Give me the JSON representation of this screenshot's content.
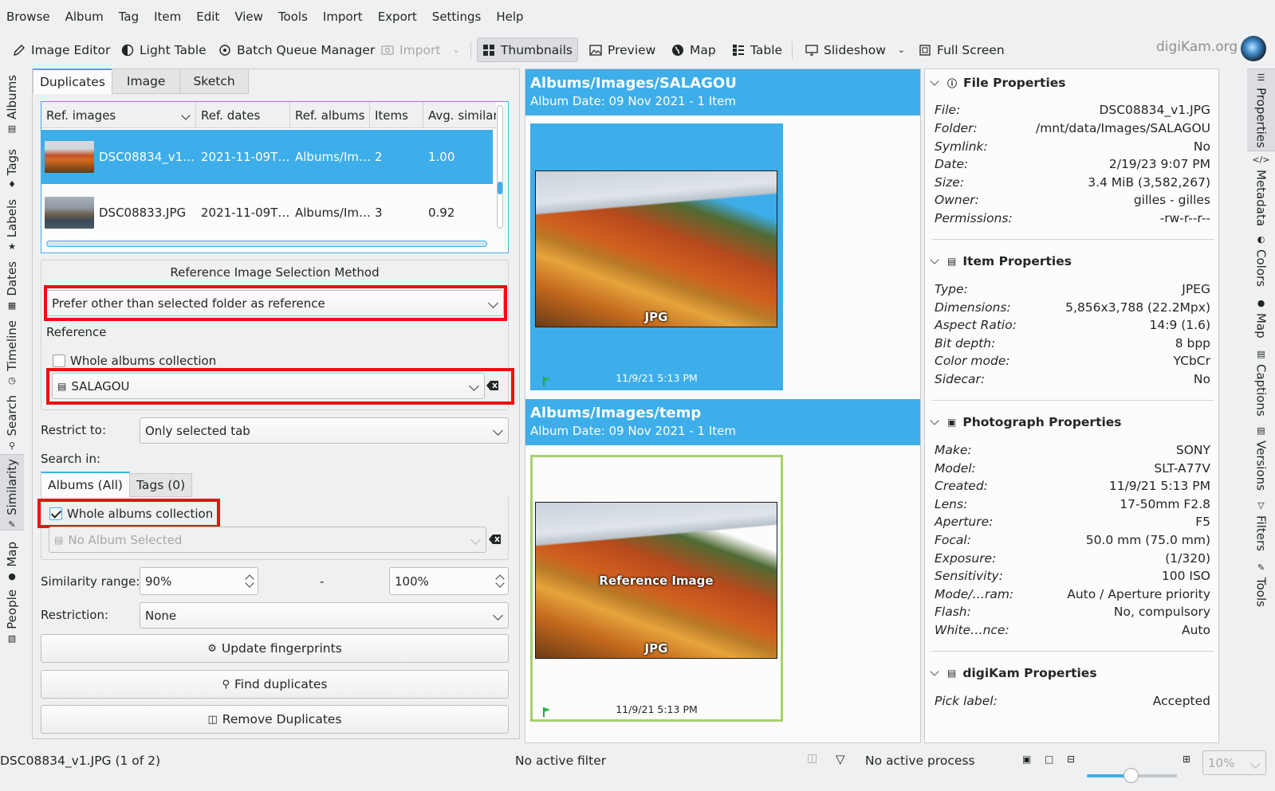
{
  "menu": [
    "Browse",
    "Album",
    "Tag",
    "Item",
    "Edit",
    "View",
    "Tools",
    "Import",
    "Export",
    "Settings",
    "Help"
  ],
  "toolbar": {
    "image_editor": "Image Editor",
    "light_table": "Light Table",
    "batch_queue": "Batch Queue Manager",
    "import": "Import",
    "thumbnails": "Thumbnails",
    "preview": "Preview",
    "map": "Map",
    "table": "Table",
    "slideshow": "Slideshow",
    "full_screen": "Full Screen",
    "brand": "digiKam.org"
  },
  "left_sidebar": [
    "Albums",
    "Tags",
    "Labels",
    "Dates",
    "Timeline",
    "Search",
    "Similarity",
    "Map",
    "People"
  ],
  "right_sidebar": [
    "Properties",
    "Metadata",
    "Colors",
    "Map",
    "Captions",
    "Versions",
    "Filters",
    "Tools"
  ],
  "panel_tabs": [
    "Duplicates",
    "Image",
    "Sketch"
  ],
  "table": {
    "headers": [
      "Ref. images",
      "Ref. dates",
      "Ref. albums",
      "Items",
      "Avg. similar"
    ],
    "rows": [
      {
        "name": "DSC08834_v1…",
        "date": "2021-11-09T…",
        "album": "Albums/Im…",
        "items": "2",
        "similarity": "1.00"
      },
      {
        "name": "DSC08833.JPG",
        "date": "2021-11-09T…",
        "album": "Albums/Im…",
        "items": "3",
        "similarity": "0.92"
      }
    ]
  },
  "ref_method": {
    "title": "Reference Image Selection Method",
    "value": "Prefer other than selected folder as reference",
    "reference_label": "Reference",
    "whole_albums": "Whole albums collection",
    "album": "SALAGOU"
  },
  "restrict": {
    "label": "Restrict to:",
    "value": "Only selected tab"
  },
  "search_in": {
    "label": "Search in:",
    "tabs": [
      "Albums (All)",
      "Tags (0)"
    ],
    "whole_albums": "Whole albums collection",
    "album_placeholder": "No Album Selected"
  },
  "similarity": {
    "label": "Similarity range:",
    "min": "90%",
    "dash": "-",
    "max": "100%"
  },
  "restriction": {
    "label": "Restriction:",
    "value": "None"
  },
  "buttons": {
    "update": "Update fingerprints",
    "find": "Find duplicates",
    "remove": "Remove Duplicates"
  },
  "albums": [
    {
      "title": "Albums/Images/SALAGOU",
      "subtitle": "Album Date: 09 Nov 2021 - 1 Item",
      "format": "JPG",
      "overlay": "",
      "date": "11/9/21 5:13 PM"
    },
    {
      "title": "Albums/Images/temp",
      "subtitle": "Album Date: 09 Nov 2021 - 1 Item",
      "format": "JPG",
      "overlay": "Reference Image",
      "date": "11/9/21 5:13 PM"
    }
  ],
  "properties": {
    "file": {
      "title": "File Properties",
      "rows": [
        [
          "File:",
          "DSC08834_v1.JPG"
        ],
        [
          "Folder:",
          "/mnt/data/Images/SALAGOU"
        ],
        [
          "Symlink:",
          "No"
        ],
        [
          "Date:",
          "2/19/23 9:07 PM"
        ],
        [
          "Size:",
          "3.4 MiB (3,582,267)"
        ],
        [
          "Owner:",
          "gilles - gilles"
        ],
        [
          "Permissions:",
          "-rw-r--r--"
        ]
      ]
    },
    "item": {
      "title": "Item Properties",
      "rows": [
        [
          "Type:",
          "JPEG"
        ],
        [
          "Dimensions:",
          "5,856x3,788 (22.2Mpx)"
        ],
        [
          "Aspect Ratio:",
          "14:9 (1.6)"
        ],
        [
          "Bit depth:",
          "8 bpp"
        ],
        [
          "Color mode:",
          "YCbCr"
        ],
        [
          "Sidecar:",
          "No"
        ]
      ]
    },
    "photo": {
      "title": "Photograph Properties",
      "rows": [
        [
          "Make:",
          "SONY"
        ],
        [
          "Model:",
          "SLT-A77V"
        ],
        [
          "Created:",
          "11/9/21 5:13 PM"
        ],
        [
          "Lens:",
          "17-50mm F2.8"
        ],
        [
          "Aperture:",
          "F5"
        ],
        [
          "Focal:",
          "50.0 mm (75.0 mm)"
        ],
        [
          "Exposure:",
          "(1/320)"
        ],
        [
          "Sensitivity:",
          "100 ISO"
        ],
        [
          "Mode/…ram:",
          "Auto / Aperture priority"
        ],
        [
          "Flash:",
          "No, compulsory"
        ],
        [
          "White…nce:",
          "Auto"
        ]
      ]
    },
    "digikam": {
      "title": "digiKam Properties",
      "rows": [
        [
          "Pick label:",
          "Accepted"
        ]
      ]
    }
  },
  "status": {
    "left": "DSC08834_v1.JPG (1 of 2)",
    "filter": "No active filter",
    "process": "No active process",
    "zoom": "10%"
  },
  "colors": {
    "accent": "#3daee9",
    "highlight_red": "#ed1010",
    "reference_border": "#a6d06e"
  }
}
